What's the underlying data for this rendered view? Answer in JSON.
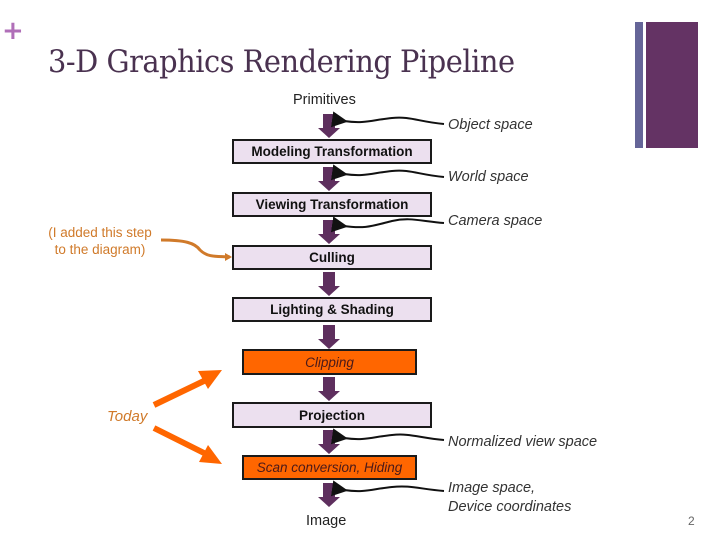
{
  "slide": {
    "bullet": "+",
    "title": "3-D Graphics Rendering Pipeline",
    "page_number": "2",
    "accent_colors": {
      "title": "#4a3250",
      "bar_narrow": "#656598",
      "bar_wide": "#643364",
      "plus": "#b06fb8",
      "annotation": "#d07a2a",
      "highlight": "#ff6600"
    }
  },
  "pipeline": {
    "input_label": "Primitives",
    "output_label": "Image",
    "stages": [
      {
        "label": "Modeling Transformation",
        "highlight": false
      },
      {
        "label": "Viewing Transformation",
        "highlight": false
      },
      {
        "label": "Culling",
        "highlight": false
      },
      {
        "label": "Lighting & Shading",
        "highlight": false
      },
      {
        "label": "Clipping",
        "highlight": true
      },
      {
        "label": "Projection",
        "highlight": false
      },
      {
        "label": "Scan conversion, Hiding",
        "highlight": true
      }
    ],
    "spaces": [
      "Object space",
      "World space",
      "Camera space",
      "Normalized view space",
      "Image space,",
      "Device coordinates"
    ]
  },
  "annotations": {
    "added_step_line1": "(I added this step",
    "added_step_line2": "to the diagram)",
    "today": "Today"
  }
}
